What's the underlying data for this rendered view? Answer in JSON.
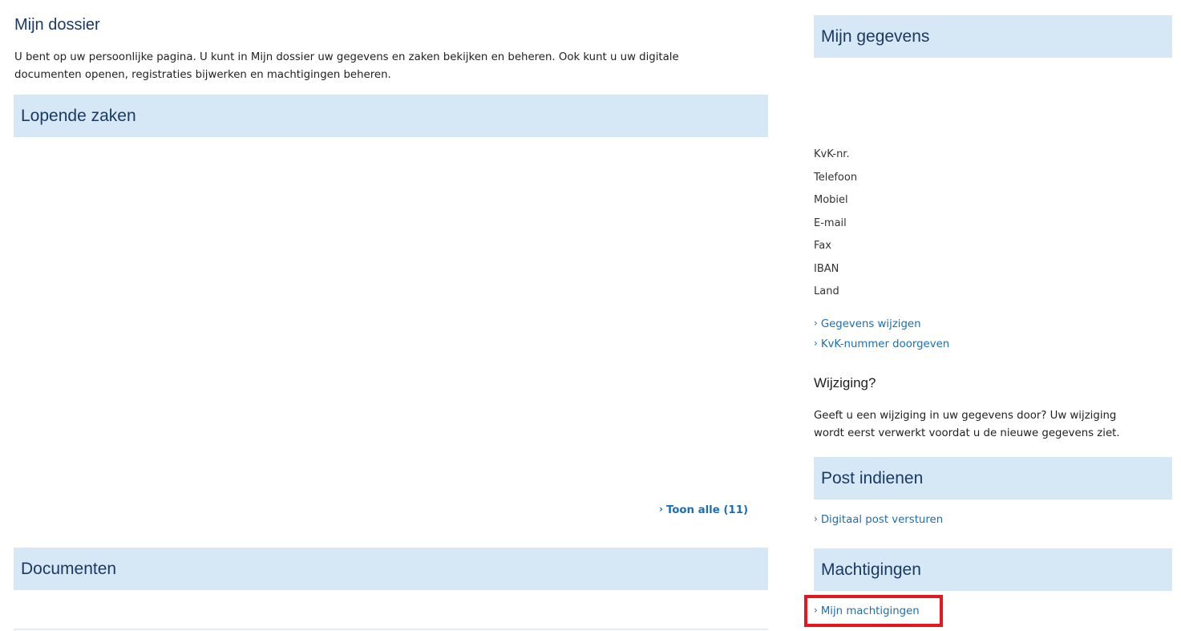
{
  "main": {
    "title": "Mijn dossier",
    "intro_line1": "U bent op uw persoonlijke pagina. U kunt in Mijn dossier uw gegevens en zaken bekijken en beheren. Ook kunt u uw digitale",
    "intro_line2": "documenten openen, registraties bijwerken en machtigingen beheren.",
    "lopende_zaken": {
      "title": "Lopende zaken",
      "show_all_label": "Toon alle (11)"
    },
    "documenten": {
      "title": "Documenten"
    }
  },
  "sidebar": {
    "gegevens": {
      "title": "Mijn gegevens",
      "fields": [
        "KvK-nr.",
        "Telefoon",
        "Mobiel",
        "E-mail",
        "Fax",
        "IBAN",
        "Land"
      ],
      "links": [
        "Gegevens wijzigen",
        "KvK-nummer doorgeven"
      ]
    },
    "wijziging": {
      "title": "Wijziging?",
      "text_line1": "Geeft u een wijziging in uw gegevens door? Uw wijziging",
      "text_line2": "wordt eerst verwerkt voordat u de nieuwe gegevens ziet."
    },
    "post": {
      "title": "Post indienen",
      "link": "Digitaal post versturen"
    },
    "machtigingen": {
      "title": "Machtigingen",
      "link": "Mijn machtigingen"
    }
  },
  "colors": {
    "section_bar": "#d6e8f5",
    "heading": "#1b3a63",
    "link": "#1a6fb5",
    "highlight": "#e3171e"
  },
  "icons": {
    "link_chevron": "chevron-right-icon"
  }
}
